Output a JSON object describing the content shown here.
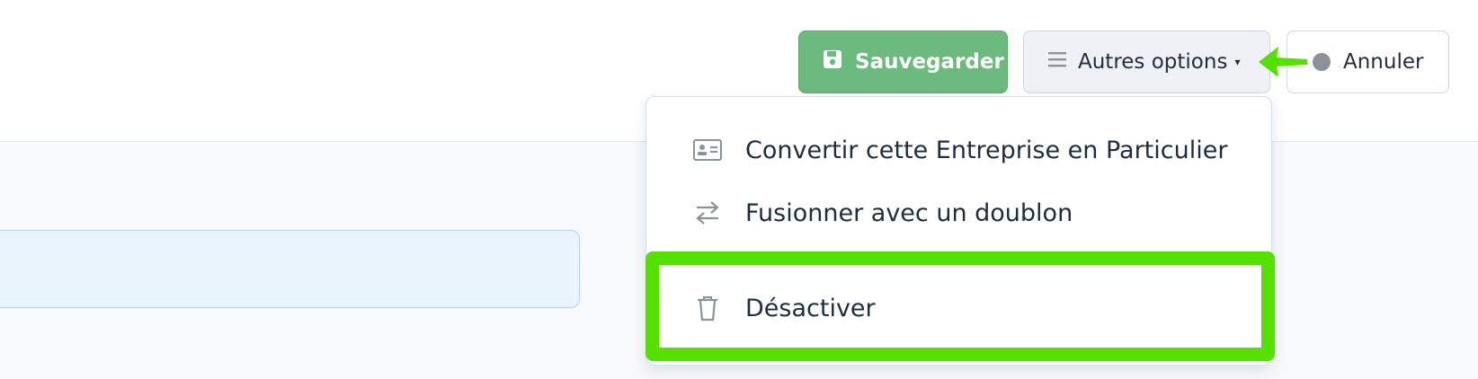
{
  "toolbar": {
    "save_label": "Sauvegarder",
    "options_label": "Autres options",
    "options_caret": "▾",
    "cancel_label": "Annuler"
  },
  "dropdown": {
    "items": [
      {
        "label": "Convertir cette Entreprise en Particulier",
        "icon": "id-card-icon"
      },
      {
        "label": "Fusionner avec un doublon",
        "icon": "swap-arrows-icon"
      },
      {
        "label": "Désactiver",
        "icon": "trash-icon"
      }
    ]
  },
  "colors": {
    "save_button": "#6cba7e",
    "highlight": "#55e000",
    "field_background": "#eaf4fd"
  }
}
